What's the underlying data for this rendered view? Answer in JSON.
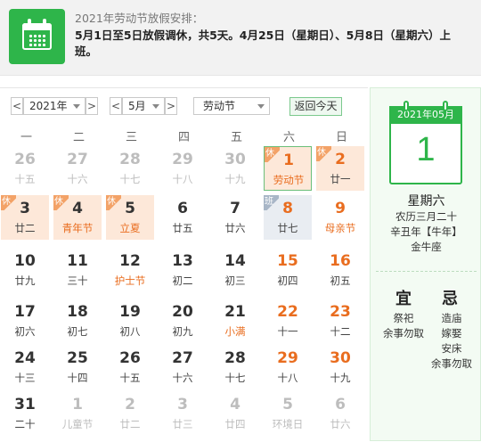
{
  "notice": {
    "label": "2021年劳动节放假安排：",
    "text": "5月1日至5日放假调休，共5天。4月25日（星期日）、5月8日（星期六）上班。"
  },
  "toolbar": {
    "prev_year": "<",
    "year": "2021年",
    "next_year": ">",
    "prev_month": "<",
    "month": "5月",
    "next_month": ">",
    "holiday": "劳动节",
    "today_button": "返回今天"
  },
  "weekdays": [
    "一",
    "二",
    "三",
    "四",
    "五",
    "六",
    "日"
  ],
  "badge_labels": {
    "rest": "休",
    "work": "班"
  },
  "days": [
    {
      "d": "26",
      "l": "十五",
      "other": true
    },
    {
      "d": "27",
      "l": "十六",
      "other": true
    },
    {
      "d": "28",
      "l": "十七",
      "other": true
    },
    {
      "d": "29",
      "l": "十八",
      "other": true
    },
    {
      "d": "30",
      "l": "十九",
      "other": true
    },
    {
      "d": "1",
      "l": "劳动节",
      "weekend": true,
      "fest": true,
      "rest": true,
      "selected": true
    },
    {
      "d": "2",
      "l": "廿一",
      "weekend": true,
      "rest": true
    },
    {
      "d": "3",
      "l": "廿二",
      "rest": true
    },
    {
      "d": "4",
      "l": "青年节",
      "fest": true,
      "rest": true
    },
    {
      "d": "5",
      "l": "立夏",
      "fest": true,
      "rest": true
    },
    {
      "d": "6",
      "l": "廿五"
    },
    {
      "d": "7",
      "l": "廿六"
    },
    {
      "d": "8",
      "l": "廿七",
      "weekend": true,
      "work": true
    },
    {
      "d": "9",
      "l": "母亲节",
      "weekend": true,
      "fest": true
    },
    {
      "d": "10",
      "l": "廿九"
    },
    {
      "d": "11",
      "l": "三十"
    },
    {
      "d": "12",
      "l": "护士节",
      "fest": true
    },
    {
      "d": "13",
      "l": "初二"
    },
    {
      "d": "14",
      "l": "初三"
    },
    {
      "d": "15",
      "l": "初四",
      "weekend": true
    },
    {
      "d": "16",
      "l": "初五",
      "weekend": true
    },
    {
      "d": "17",
      "l": "初六"
    },
    {
      "d": "18",
      "l": "初七"
    },
    {
      "d": "19",
      "l": "初八"
    },
    {
      "d": "20",
      "l": "初九"
    },
    {
      "d": "21",
      "l": "小满",
      "fest": true
    },
    {
      "d": "22",
      "l": "十一",
      "weekend": true
    },
    {
      "d": "23",
      "l": "十二",
      "weekend": true
    },
    {
      "d": "24",
      "l": "十三"
    },
    {
      "d": "25",
      "l": "十四"
    },
    {
      "d": "26",
      "l": "十五"
    },
    {
      "d": "27",
      "l": "十六"
    },
    {
      "d": "28",
      "l": "十七"
    },
    {
      "d": "29",
      "l": "十八",
      "weekend": true
    },
    {
      "d": "30",
      "l": "十九",
      "weekend": true
    },
    {
      "d": "31",
      "l": "二十"
    },
    {
      "d": "1",
      "l": "儿童节",
      "other": true
    },
    {
      "d": "2",
      "l": "廿二",
      "other": true
    },
    {
      "d": "3",
      "l": "廿三",
      "other": true
    },
    {
      "d": "4",
      "l": "廿四",
      "other": true
    },
    {
      "d": "5",
      "l": "环境日",
      "other": true
    },
    {
      "d": "6",
      "l": "廿六",
      "other": true
    }
  ],
  "detail": {
    "header": "2021年05月",
    "day": "1",
    "weekday": "星期六",
    "lunar": "农历三月二十",
    "ganzhi": "辛丑年【牛年】",
    "zodiac": "金牛座",
    "yi_title": "宜",
    "ji_title": "忌",
    "yi": [
      "祭祀",
      "余事勿取"
    ],
    "ji": [
      "造庙",
      "嫁娶",
      "安床",
      "余事勿取"
    ]
  },
  "colors": {
    "accent": "#2eb54a",
    "weekend": "#e96d1f",
    "rest_bg": "#fde8d9",
    "work_bg": "#e9edf2"
  }
}
